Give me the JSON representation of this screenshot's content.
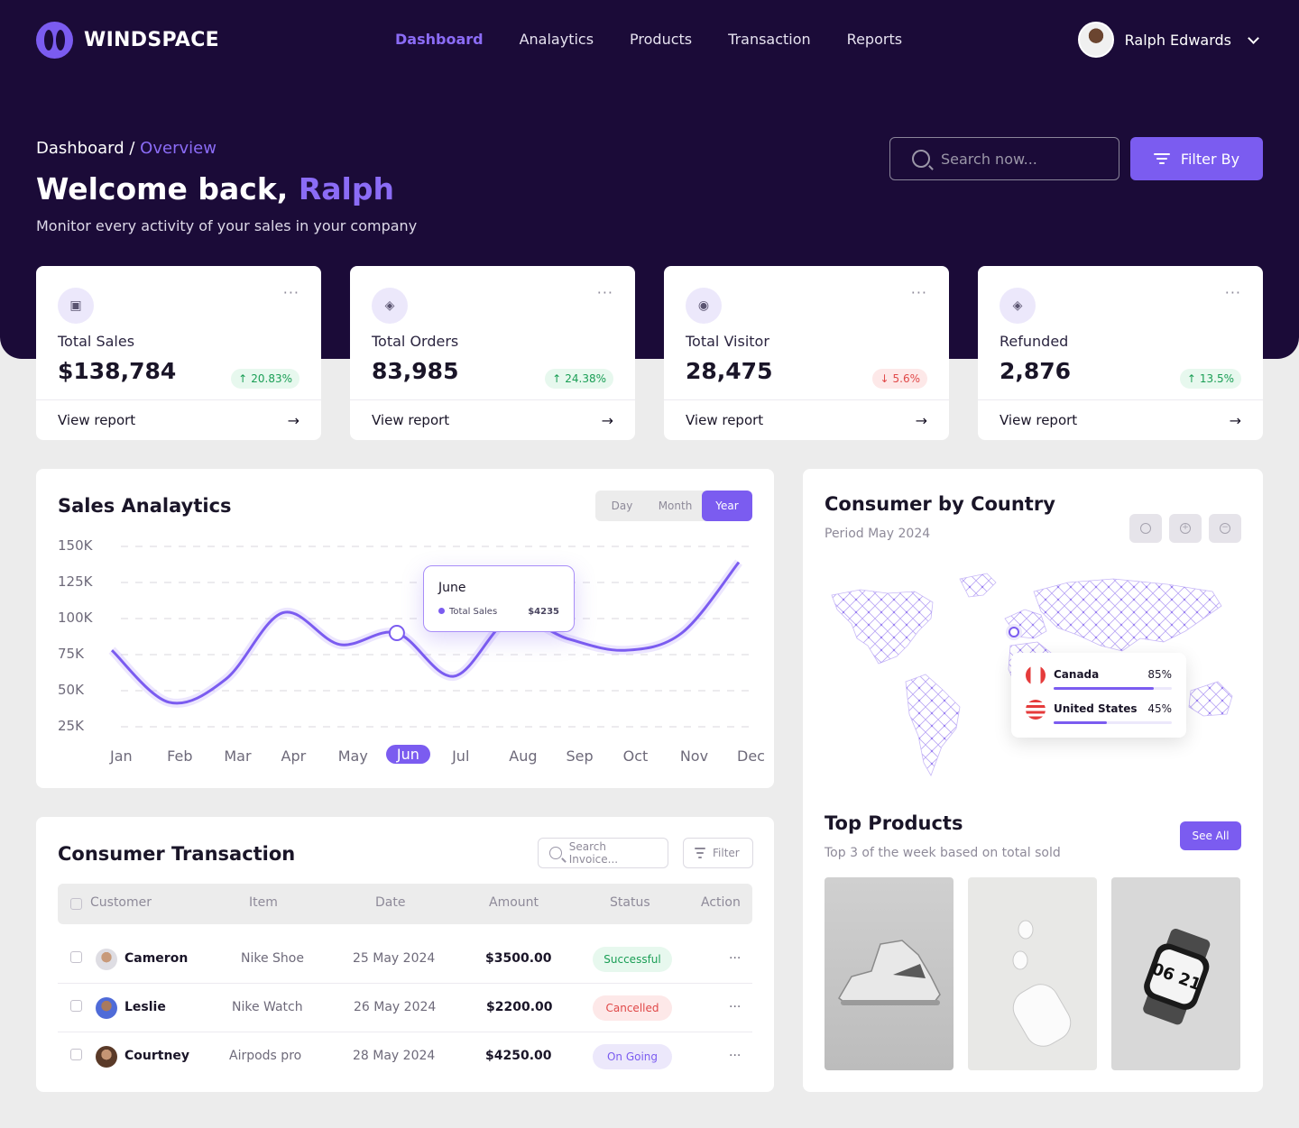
{
  "brand": {
    "name": "WINDSPACE"
  },
  "nav": [
    "Dashboard",
    "Analaytics",
    "Products",
    "Transaction",
    "Reports"
  ],
  "user": {
    "name": "Ralph Edwards"
  },
  "breadcrumb": {
    "root": "Dashboard",
    "sep": " / ",
    "current": "Overview"
  },
  "welcome": {
    "prefix": "Welcome back, ",
    "name": "Ralph",
    "subtitle": "Monitor every activity of your sales in your company"
  },
  "search": {
    "placeholder": "Search now..."
  },
  "filter_label": "Filter By",
  "stats": [
    {
      "label": "Total Sales",
      "value": "$138,784",
      "change": "20.83%",
      "trend": "up",
      "link": "View report",
      "icon": "chart-icon"
    },
    {
      "label": "Total Orders",
      "value": "83,985",
      "change": "24.38%",
      "trend": "up",
      "link": "View report",
      "icon": "box-icon"
    },
    {
      "label": "Total Visitor",
      "value": "28,475",
      "change": "5.6%",
      "trend": "down",
      "link": "View report",
      "icon": "eye-icon"
    },
    {
      "label": "Refunded",
      "value": "2,876",
      "change": "13.5%",
      "trend": "up",
      "link": "View report",
      "icon": "refund-box-icon"
    }
  ],
  "sales": {
    "title": "Sales Analaytics",
    "periods": [
      "Day",
      "Month",
      "Year"
    ],
    "active_period": "Year",
    "tooltip": {
      "month": "June",
      "series": "Total Sales",
      "value": "$4235"
    }
  },
  "chart_data": {
    "type": "line",
    "categories": [
      "Jan",
      "Feb",
      "Mar",
      "Apr",
      "May",
      "Jun",
      "Jul",
      "Aug",
      "Sep",
      "Oct",
      "Nov",
      "Dec"
    ],
    "yticks": [
      "150K",
      "125K",
      "100K",
      "75K",
      "50K",
      "25K"
    ],
    "ylim": [
      25,
      150
    ],
    "selected": "Jun",
    "series": [
      {
        "values": [
          78,
          42,
          58,
          104,
          82,
          90,
          60,
          100,
          86,
          78,
          90,
          139
        ]
      }
    ]
  },
  "transactions": {
    "title": "Consumer Transaction",
    "search_placeholder": "Search Invoice...",
    "filter_label": "Filter",
    "headers": [
      "Customer",
      "Item",
      "Date",
      "Amount",
      "Status",
      "Action"
    ],
    "rows": [
      {
        "name": "Cameron",
        "item": "Nike Shoe",
        "date": "25 May 2024",
        "amount": "$3500.00",
        "status": "Successful",
        "action": "···"
      },
      {
        "name": "Leslie",
        "item": "Nike Watch",
        "date": "26 May 2024",
        "amount": "$2200.00",
        "status": "Cancelled",
        "action": "···"
      },
      {
        "name": "Courtney",
        "item": "Airpods pro",
        "date": "28 May 2024",
        "amount": "$4250.00",
        "status": "On Going",
        "action": "···"
      }
    ]
  },
  "country": {
    "title": "Consumer by Country",
    "period": "Period May 2024",
    "items": [
      {
        "name": "Canada",
        "percent": "85%",
        "share": 0.85
      },
      {
        "name": "United States",
        "percent": "45%",
        "share": 0.45
      }
    ]
  },
  "top_products": {
    "title": "Top Products",
    "subtitle": "Top 3 of the week based on total sold",
    "see_all": "See All",
    "watch_text": "06 21"
  }
}
